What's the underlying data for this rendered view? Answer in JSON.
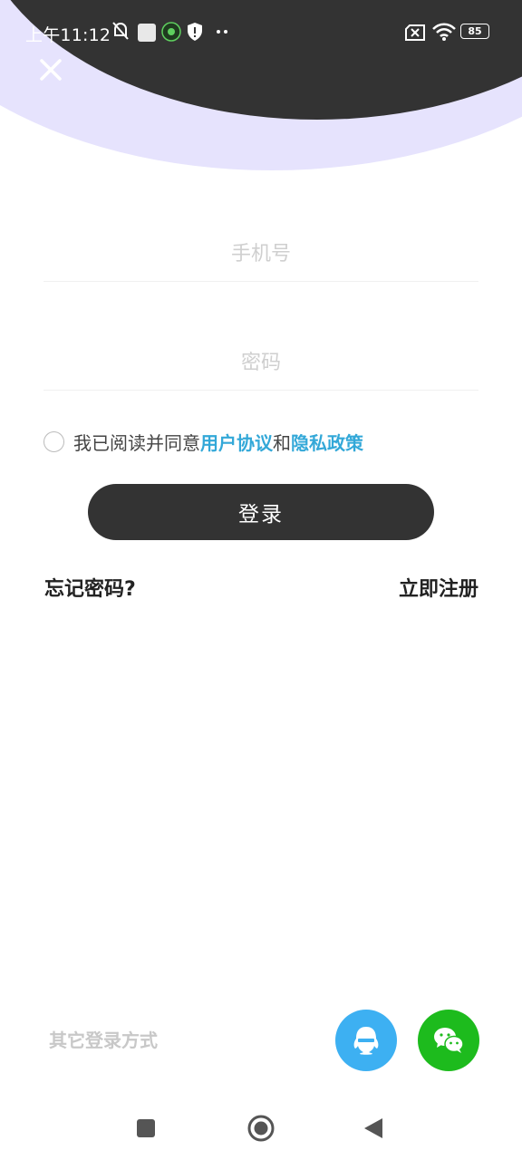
{
  "status_bar": {
    "time": "上午11:12",
    "battery": "85",
    "icons": [
      "bell-off-icon",
      "square-app-icon",
      "green-app-icon",
      "shield-icon",
      "more-dots-icon",
      "sim-off-icon",
      "wifi-icon",
      "battery-icon"
    ]
  },
  "colors": {
    "dark": "#333333",
    "lavender": "#e6e3fd",
    "link": "#33a8d8",
    "qq": "#3db0f2",
    "wechat": "#1dbb1d"
  },
  "form": {
    "phone_placeholder": "手机号",
    "password_placeholder": "密码",
    "agree_prefix": "我已阅读并同意",
    "user_agreement": "用户协议",
    "and": "和",
    "privacy_policy": "隐私政策",
    "login_label": "登录",
    "forgot_label": "忘记密码?",
    "register_label": "立即注册"
  },
  "other": {
    "label": "其它登录方式",
    "methods": [
      "qq-icon",
      "wechat-icon"
    ]
  },
  "nav": [
    "recent-apps-icon",
    "home-icon",
    "back-icon"
  ]
}
